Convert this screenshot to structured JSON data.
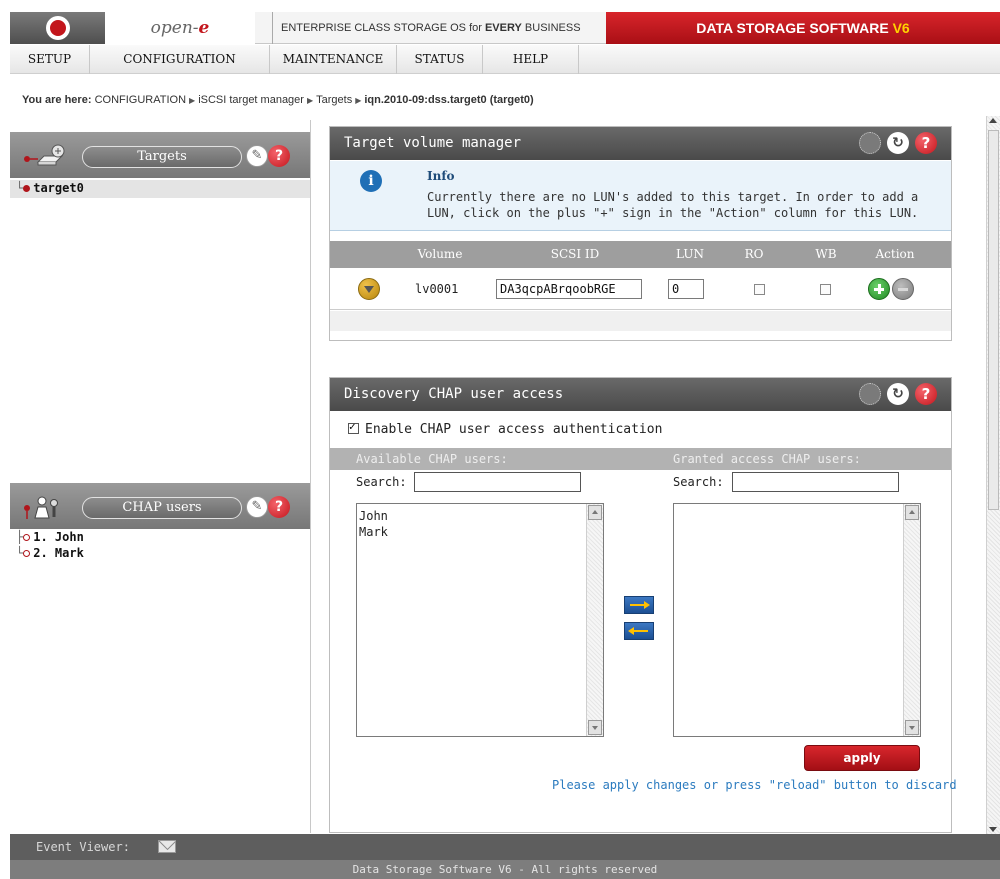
{
  "header": {
    "brand_prefix": "open-",
    "brand_suffix": "e",
    "slogan_normal": "ENTERPRISE CLASS STORAGE OS for ",
    "slogan_bold": "EVERY",
    "slogan_end": " BUSINESS",
    "product_title": "DATA STORAGE SOFTWARE ",
    "product_version": "V6"
  },
  "menu": {
    "items": [
      "SETUP",
      "CONFIGURATION",
      "MAINTENANCE",
      "STATUS",
      "HELP"
    ]
  },
  "breadcrumb": {
    "lead": "You are here:",
    "items": [
      "CONFIGURATION",
      "iSCSI target manager",
      "Targets"
    ],
    "current": "iqn.2010-09:dss.target0 (target0)"
  },
  "left_panel": {
    "targets": {
      "title": "Targets",
      "items": [
        "target0"
      ]
    },
    "chap_users": {
      "title": "CHAP users",
      "items": [
        "1. John",
        "2. Mark"
      ]
    }
  },
  "target_volume_manager": {
    "title": "Target volume manager",
    "info_title": "Info",
    "info_text": "Currently there are no LUN's added to this target. In order to add a LUN, click on the plus \"+\" sign in the \"Action\" column for this LUN.",
    "columns": [
      "Volume",
      "SCSI ID",
      "LUN",
      "RO",
      "WB",
      "Action"
    ],
    "rows": [
      {
        "volume": "lv0001",
        "scsi_id": "DA3qcpABrqoobRGE",
        "lun": "0",
        "ro": false,
        "wb": false
      }
    ]
  },
  "discovery_chap": {
    "title": "Discovery CHAP user access",
    "enable_label": "Enable CHAP user access authentication",
    "enabled": true,
    "available_label": "Available CHAP users:",
    "granted_label": "Granted access CHAP users:",
    "search_label": "Search:",
    "search_available_value": "",
    "search_granted_value": "",
    "available_users": [
      "John",
      "Mark"
    ],
    "granted_users": [],
    "apply_label": "apply",
    "apply_note": "Please apply changes or press \"reload\" button to discard"
  },
  "footer": {
    "event_viewer_label": "Event Viewer:",
    "copyright": "Data Storage Software V6 - All rights reserved"
  },
  "colors": {
    "brand_red": "#c3161c",
    "version_yellow": "#ffd200",
    "panel_header": "#555555",
    "link_blue": "#2b7bbf"
  }
}
